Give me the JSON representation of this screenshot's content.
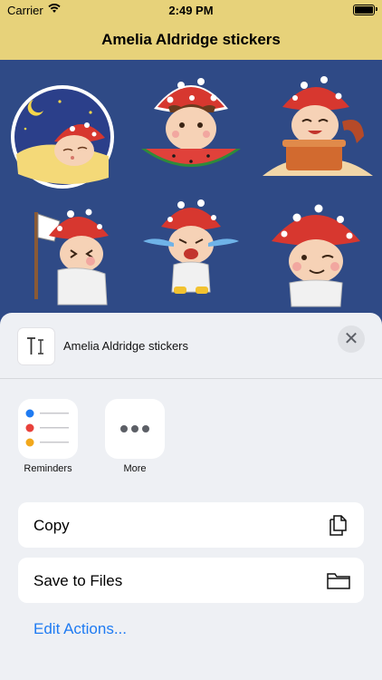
{
  "status": {
    "carrier": "Carrier",
    "time": "2:49 PM"
  },
  "nav": {
    "title": "Amelia Aldridge stickers"
  },
  "stickers": [
    {
      "name": "sleeping-sticker"
    },
    {
      "name": "watermelon-sticker"
    },
    {
      "name": "cooking-sticker"
    },
    {
      "name": "flag-sticker"
    },
    {
      "name": "crying-sticker"
    },
    {
      "name": "winking-sticker"
    }
  ],
  "share_sheet": {
    "title": "Amelia Aldridge stickers",
    "apps": [
      {
        "label": "Reminders",
        "icon": "reminders-icon"
      },
      {
        "label": "More",
        "icon": "more-icon"
      }
    ],
    "actions": [
      {
        "label": "Copy",
        "icon": "copy-icon"
      },
      {
        "label": "Save to Files",
        "icon": "folder-icon"
      }
    ],
    "edit_actions": "Edit Actions..."
  },
  "colors": {
    "nav_background": "#e7d27a",
    "sticker_background": "#2f4a86",
    "sheet_background": "#eef0f4",
    "link": "#1f7bf2",
    "mushroom_red": "#d7372f"
  }
}
